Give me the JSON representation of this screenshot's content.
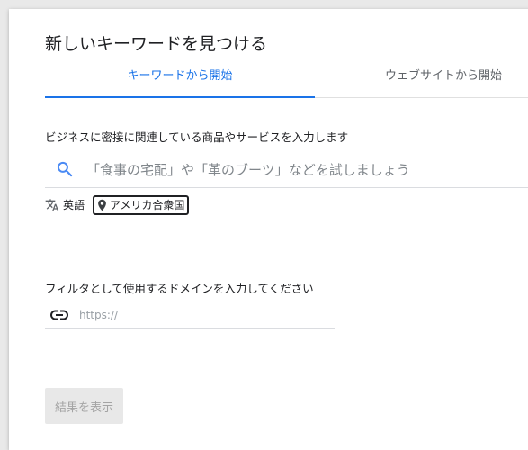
{
  "dialog": {
    "title": "新しいキーワードを見つける"
  },
  "tabs": [
    {
      "label": "キーワードから開始",
      "active": true
    },
    {
      "label": "ウェブサイトから開始",
      "active": false
    }
  ],
  "keyword_section": {
    "label": "ビジネスに密接に関連している商品やサービスを入力します",
    "placeholder": "「食事の宅配」や「革のブーツ」などを試しましょう",
    "search_icon": "search-icon"
  },
  "locale": {
    "language_icon": "translate-icon",
    "language": "英語",
    "location_icon": "location-pin-icon",
    "location": "アメリカ合衆国"
  },
  "domain_section": {
    "label": "フィルタとして使用するドメインを入力してください",
    "placeholder": "https://",
    "link_icon": "link-icon"
  },
  "actions": {
    "show_results_label": "結果を表示",
    "show_results_enabled": false
  },
  "colors": {
    "accent": "#1a73e8",
    "text": "#202124",
    "placeholder": "#80868b",
    "disabled_bg": "#e8e8e8",
    "disabled_text": "#a4a4a4"
  }
}
